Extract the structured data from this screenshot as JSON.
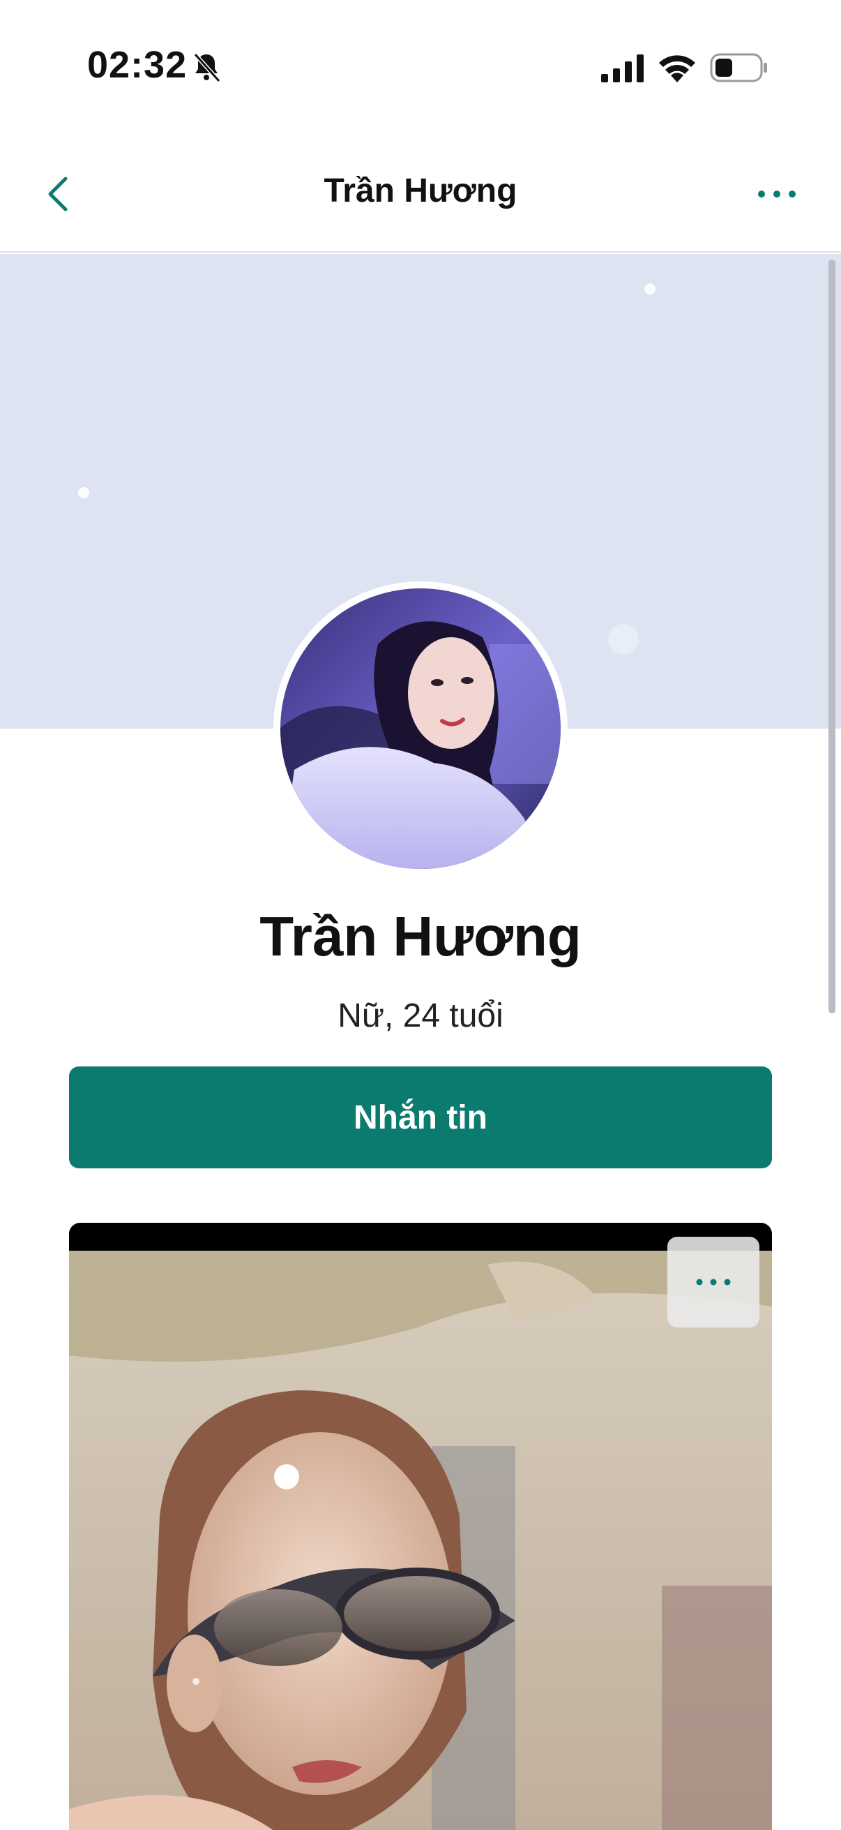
{
  "status_bar": {
    "time": "02:32",
    "icons": [
      "bell-slash-icon",
      "cellular-signal-icon",
      "wifi-icon",
      "battery-icon"
    ]
  },
  "nav": {
    "title": "Trần Hương",
    "back_icon": "chevron-left-icon",
    "more_icon": "more-horizontal-icon"
  },
  "profile": {
    "name": "Trần Hương",
    "meta": "Nữ, 24 tuổi",
    "message_button_label": "Nhắn tin"
  },
  "post": {
    "more_icon": "more-horizontal-icon"
  },
  "colors": {
    "accent": "#0b7a6f",
    "cover": "#dde3f1"
  }
}
